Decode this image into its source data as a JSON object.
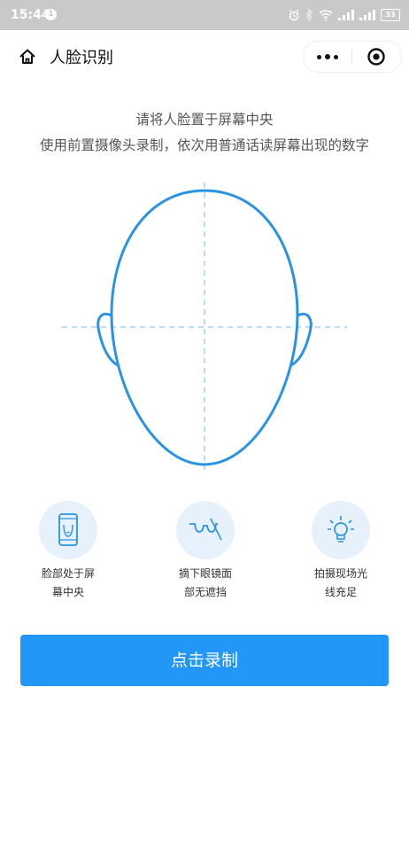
{
  "status_bar": {
    "time": "15:44",
    "notification_count": "1",
    "battery": "33"
  },
  "nav": {
    "title": "人脸识别"
  },
  "instructions": {
    "line1": "请将人脸置于屏幕中央",
    "line2": "使用前置摄像头录制，依次用普通话读屏幕出现的数字"
  },
  "tips": [
    {
      "icon": "phone-face-icon",
      "line1": "脸部处于屏",
      "line2": "幕中央"
    },
    {
      "icon": "glasses-icon",
      "line1": "摘下眼镜面",
      "line2": "部无遮挡"
    },
    {
      "icon": "lightbulb-icon",
      "line1": "拍摄现场光",
      "line2": "线充足"
    }
  ],
  "record_button": {
    "label": "点击录制"
  },
  "colors": {
    "accent": "#2297f7",
    "guide_line": "#9fd2f7",
    "tip_bg": "#e6f1fb"
  }
}
